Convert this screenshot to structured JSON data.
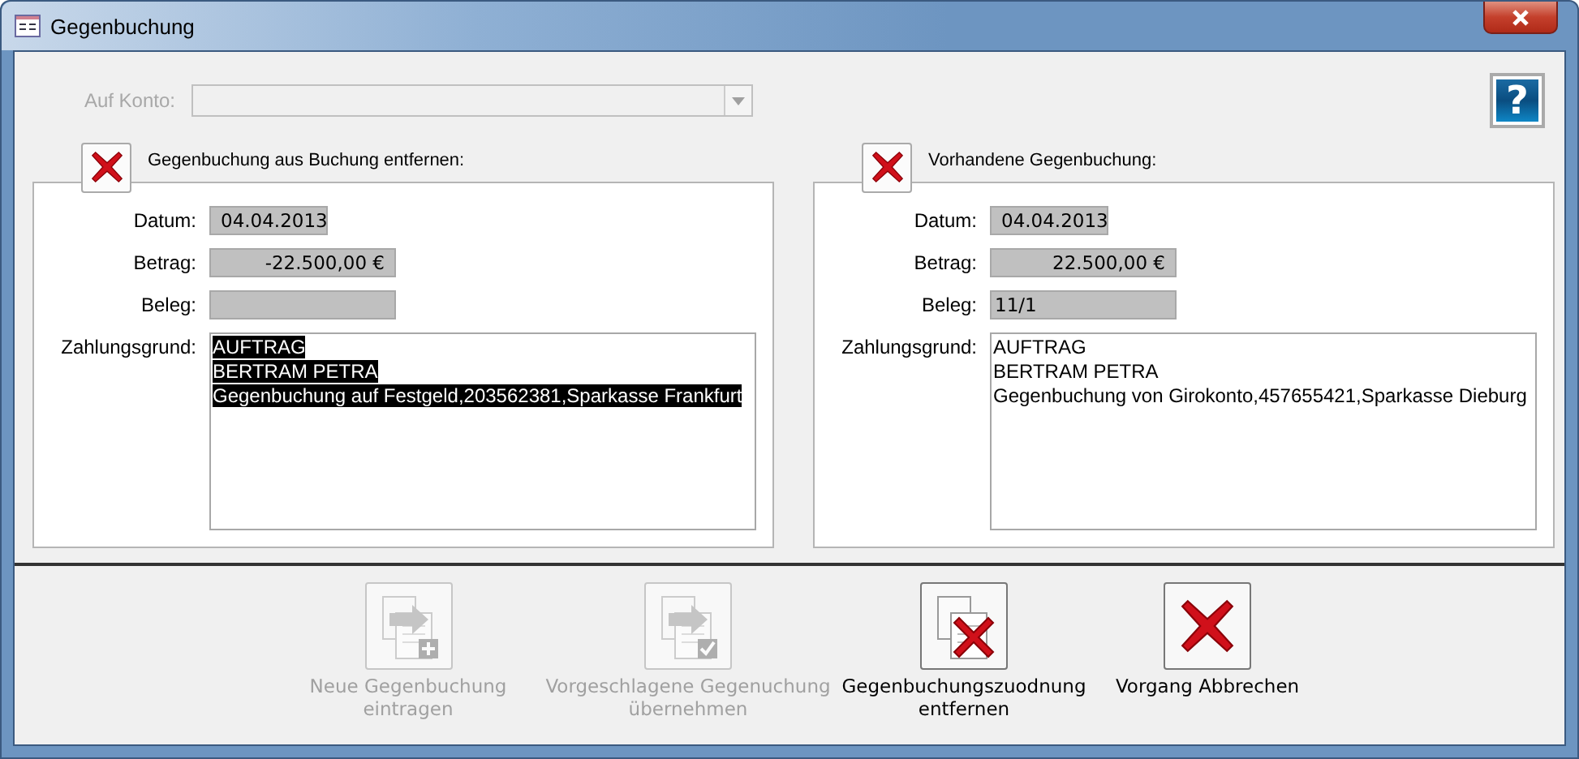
{
  "window": {
    "title": "Gegenbuchung"
  },
  "account": {
    "label": "Auf Konto:",
    "disabled": true
  },
  "help_button": {
    "label": "?"
  },
  "panels": [
    {
      "title": "Gegenbuchung aus Buchung entfernen:",
      "fields": [
        {
          "label": "Datum:",
          "value": "04.04.2013",
          "kind": "date"
        },
        {
          "label": "Betrag:",
          "value": "-22.500,00 €",
          "kind": "amount"
        },
        {
          "label": "Beleg:",
          "kind": "text"
        }
      ],
      "reason_label": "Zahlungsgrund:",
      "reason_lines": [
        "AUFTRAG",
        "BERTRAM PETRA",
        "Gegenbuchung auf Festgeld,203562381,Sparkasse Frankfurt"
      ],
      "reason_selected": true
    },
    {
      "title": "Vorhandene Gegenbuchung:",
      "fields": [
        {
          "label": "Datum:",
          "value": "04.04.2013",
          "kind": "date"
        },
        {
          "label": "Betrag:",
          "value": "22.500,00 €",
          "kind": "amount"
        },
        {
          "label": "Beleg:",
          "value": "11/1",
          "kind": "text"
        }
      ],
      "reason_label": "Zahlungsgrund:",
      "reason_lines": [
        "AUFTRAG",
        "BERTRAM PETRA",
        "Gegenbuchung von Girokonto,457655421,Sparkasse Dieburg"
      ],
      "reason_selected": false
    }
  ],
  "actions": [
    {
      "label": "Neue Gegenbuchung eintragen",
      "kind": "add",
      "disabled": true
    },
    {
      "label": "Vorgeschlagene Gegenuchung übernehmen",
      "kind": "accept",
      "disabled": true
    },
    {
      "label": "Gegenbuchungszuodnung entfernen",
      "kind": "unlink",
      "disabled": false
    },
    {
      "label": "Vorgang Abbrechen",
      "kind": "cancel",
      "disabled": false
    }
  ]
}
